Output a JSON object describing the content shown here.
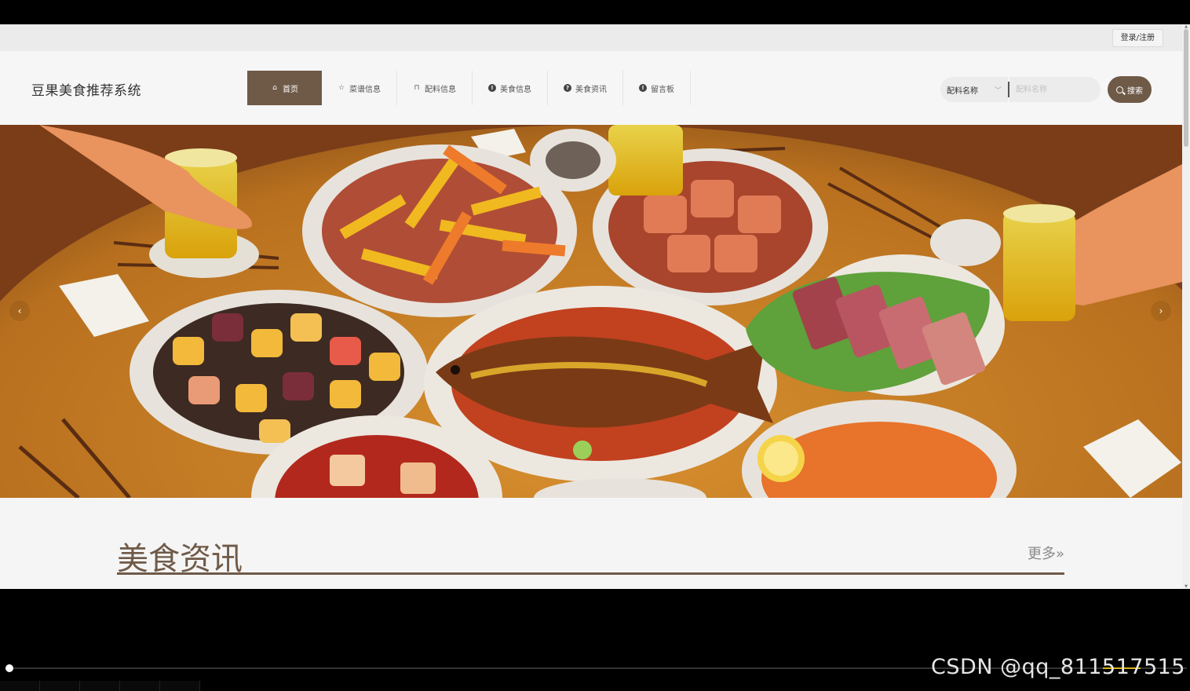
{
  "topbar": {
    "login_label": "登录/注册"
  },
  "header": {
    "site_title": "豆果美食推荐系统",
    "nav": [
      {
        "label": "首页",
        "icon": "home-icon",
        "active": true
      },
      {
        "label": "菜谱信息",
        "icon": "star-icon",
        "active": false
      },
      {
        "label": "配料信息",
        "icon": "bag-icon",
        "active": false
      },
      {
        "label": "美食信息",
        "icon": "info-icon",
        "active": false
      },
      {
        "label": "美食资讯",
        "icon": "question-icon",
        "active": false
      },
      {
        "label": "留言板",
        "icon": "info-icon",
        "active": false
      }
    ],
    "search": {
      "select_value": "配料名称",
      "placeholder": "配料名称",
      "button_label": "搜索"
    }
  },
  "section": {
    "title": "美食资讯",
    "more_label": "更多»"
  },
  "watermark": "CSDN @qq_811517515",
  "colors": {
    "accent": "#6f5a48",
    "table": "#c27d27"
  }
}
